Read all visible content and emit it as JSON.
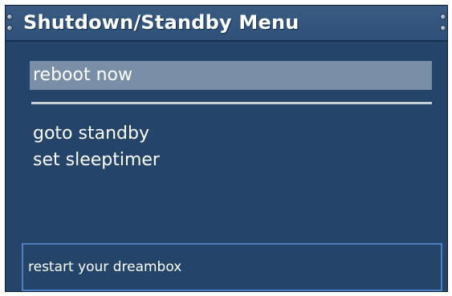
{
  "window": {
    "title": "Shutdown/Standby Menu"
  },
  "menu": {
    "items": [
      {
        "label": "reboot now",
        "selected": true
      },
      {
        "label": "goto standby",
        "selected": false
      },
      {
        "label": "set sleeptimer",
        "selected": false
      }
    ]
  },
  "statusbar": {
    "text": "restart your dreambox"
  },
  "colors": {
    "panel_background": "#24446a",
    "titlebar": "#3a5c83",
    "selection": "#7a8ea7",
    "status_border": "#4f7fc0",
    "text": "#ffffff"
  }
}
